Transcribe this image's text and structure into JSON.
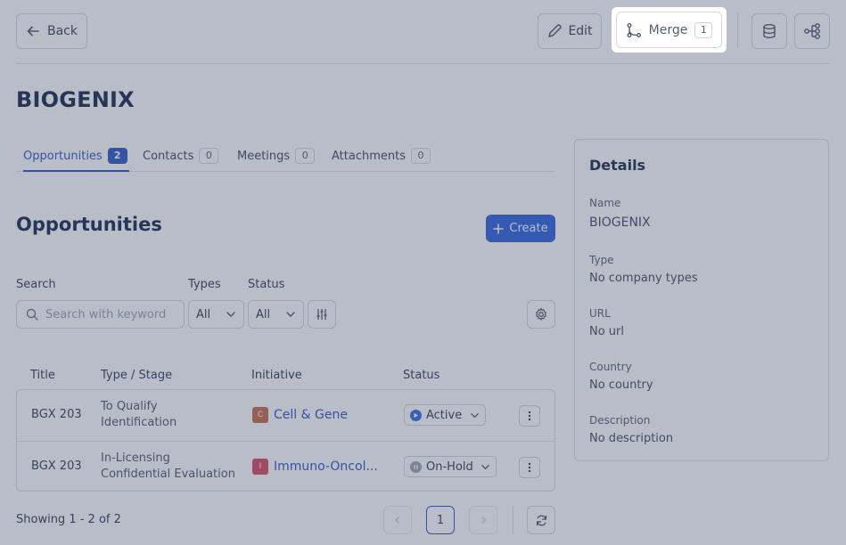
{
  "header": {
    "back_label": "Back",
    "edit_label": "Edit",
    "merge_label": "Merge",
    "merge_count": "1"
  },
  "company": {
    "name": "BIOGENIX"
  },
  "tabs": [
    {
      "label": "Opportunities",
      "count": "2",
      "active": true
    },
    {
      "label": "Contacts",
      "count": "0"
    },
    {
      "label": "Meetings",
      "count": "0"
    },
    {
      "label": "Attachments",
      "count": "0"
    }
  ],
  "section": {
    "title": "Opportunities",
    "create_label": "Create"
  },
  "filters": {
    "search_label": "Search",
    "search_placeholder": "Search with keyword",
    "types_label": "Types",
    "types_value": "All",
    "status_label": "Status",
    "status_value": "All"
  },
  "table": {
    "headers": [
      "Title",
      "Type / Stage",
      "Initiative",
      "Status"
    ],
    "rows": [
      {
        "title": "BGX 203",
        "type": "To Qualify",
        "stage": "Identification",
        "initiative_badge": "C",
        "initiative": "Cell & Gene",
        "status": "Active"
      },
      {
        "title": "BGX 203",
        "type": "In-Licensing",
        "stage": "Confidential Evaluation",
        "initiative_badge": "I",
        "initiative": "Immuno-Oncol...",
        "status": "On-Hold"
      }
    ]
  },
  "pagination": {
    "showing": "Showing 1 - 2 of 2",
    "current_page": "1"
  },
  "details": {
    "title": "Details",
    "name_label": "Name",
    "name_value": "BIOGENIX",
    "type_label": "Type",
    "type_value": "No company types",
    "url_label": "URL",
    "url_value": "No url",
    "country_label": "Country",
    "country_value": "No country",
    "description_label": "Description",
    "description_value": "No description"
  },
  "colors": {
    "accent": "#2d55c8",
    "create_button": "#2d5fe0",
    "badge_cell_gene": "#c96a4a",
    "badge_immuno": "#d9485f",
    "status_active": "#2d6fe0",
    "status_on_hold": "#9aa3b5",
    "overlay": "#44526c"
  },
  "icons": {
    "back": "arrow-left-icon",
    "edit": "pencil-icon",
    "merge": "merge-icon",
    "database": "database-icon",
    "hierarchy": "hierarchy-icon",
    "create": "plus-icon",
    "search": "search-icon",
    "filter": "sliders-icon",
    "settings": "gear-icon",
    "refresh": "refresh-icon"
  }
}
